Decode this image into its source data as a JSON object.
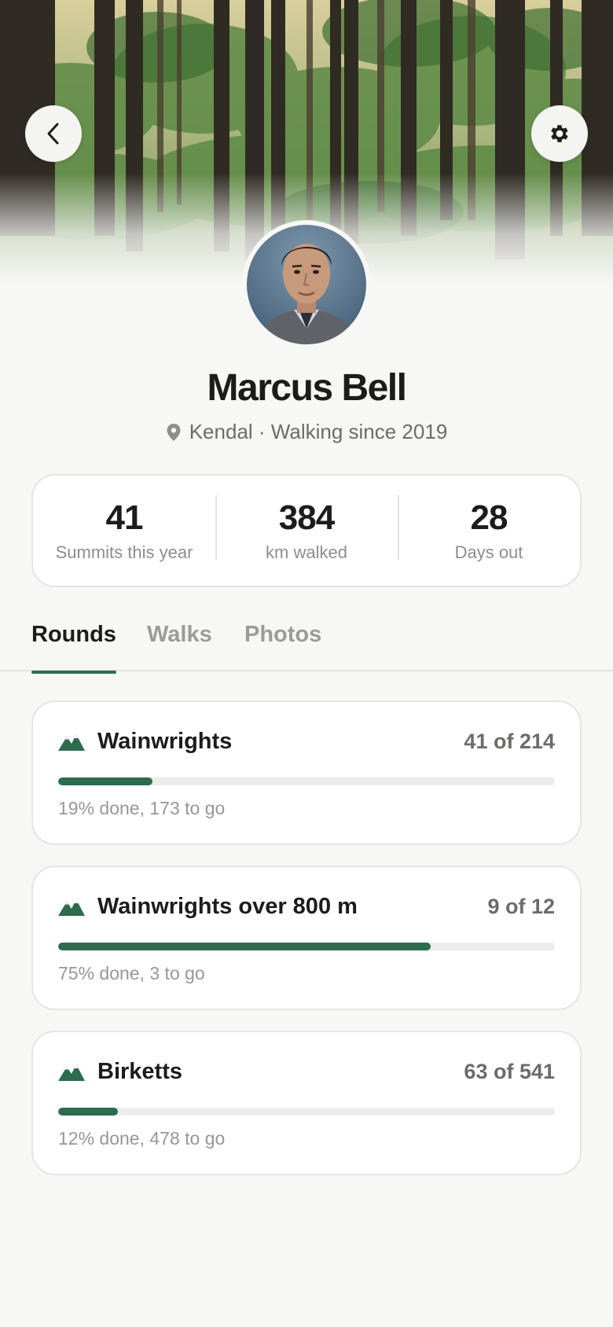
{
  "header": {
    "back_icon": "chevron-left-icon",
    "settings_icon": "gear-icon"
  },
  "profile": {
    "name": "Marcus Bell",
    "location_icon": "location-pin-icon",
    "meta": "Kendal · Walking since 2019"
  },
  "stats": [
    {
      "value": "41",
      "label": "Summits this year"
    },
    {
      "value": "384",
      "label": "km walked"
    },
    {
      "value": "28",
      "label": "Days out"
    }
  ],
  "tabs": [
    {
      "label": "Rounds",
      "active": true
    },
    {
      "label": "Walks",
      "active": false
    },
    {
      "label": "Photos",
      "active": false
    }
  ],
  "rounds": [
    {
      "title": "Wainwrights",
      "count": "41 of 214",
      "progress": 0.19,
      "summary": "19% done, 173 to go",
      "icon": "mountains-icon"
    },
    {
      "title": "Wainwrights over 800 m",
      "count": "9 of 12",
      "progress": 0.75,
      "summary": "75% done, 3 to go",
      "icon": "mountains-icon"
    },
    {
      "title": "Birketts",
      "count": "63 of 541",
      "progress": 0.12,
      "summary": "12% done, 478 to go",
      "icon": "mountains-icon"
    }
  ],
  "colors": {
    "accent": "#2e6b4f",
    "background": "#f7f7f5",
    "card": "#ffffff"
  }
}
